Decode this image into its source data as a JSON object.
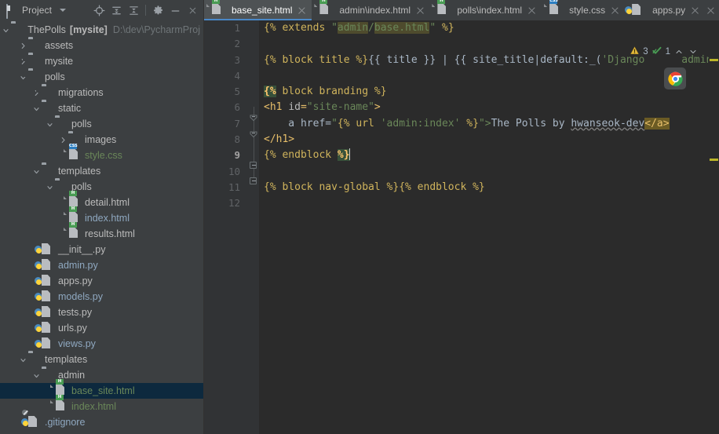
{
  "project_panel": {
    "title": "Project",
    "window_icon": "project-window-icon",
    "tools": [
      {
        "name": "locate-icon",
        "title": "Select Opened File"
      },
      {
        "name": "expand-all-icon",
        "title": "Expand All"
      },
      {
        "name": "collapse-all-icon",
        "title": "Collapse All"
      },
      {
        "name": "gear-icon",
        "title": "Settings"
      },
      {
        "name": "minimize-icon",
        "title": "Hide"
      },
      {
        "name": "close-icon",
        "title": "Close"
      }
    ],
    "tree": [
      {
        "depth": 0,
        "arrow": "down",
        "icon": "folder",
        "label": "ThePolls",
        "suffix": "[mysite]",
        "path": "D:\\dev\\PycharmProj",
        "style": "white"
      },
      {
        "depth": 1,
        "arrow": "right",
        "icon": "folder",
        "label": "assets",
        "style": "white"
      },
      {
        "depth": 1,
        "arrow": "right",
        "icon": "folder-module",
        "label": "mysite",
        "style": "white"
      },
      {
        "depth": 1,
        "arrow": "down",
        "icon": "folder-module",
        "label": "polls",
        "style": "white"
      },
      {
        "depth": 2,
        "arrow": "right",
        "icon": "folder-module",
        "label": "migrations",
        "style": "white"
      },
      {
        "depth": 2,
        "arrow": "down",
        "icon": "folder",
        "label": "static",
        "style": "white"
      },
      {
        "depth": 3,
        "arrow": "down",
        "icon": "folder",
        "label": "polls",
        "style": "white"
      },
      {
        "depth": 4,
        "arrow": "right",
        "icon": "folder",
        "label": "images",
        "style": "white"
      },
      {
        "depth": 4,
        "arrow": "none",
        "icon": "css-file",
        "label": "style.css",
        "style": "green"
      },
      {
        "depth": 2,
        "arrow": "down",
        "icon": "folder",
        "label": "templates",
        "style": "white"
      },
      {
        "depth": 3,
        "arrow": "down",
        "icon": "folder",
        "label": "polls",
        "style": "white"
      },
      {
        "depth": 4,
        "arrow": "none",
        "icon": "html-file",
        "label": "detail.html",
        "style": "white"
      },
      {
        "depth": 4,
        "arrow": "none",
        "icon": "html-file",
        "label": "index.html",
        "style": "blue"
      },
      {
        "depth": 4,
        "arrow": "none",
        "icon": "html-file",
        "label": "results.html",
        "style": "white"
      },
      {
        "depth": 2,
        "arrow": "none",
        "icon": "py-file",
        "label": "__init__.py",
        "style": "white"
      },
      {
        "depth": 2,
        "arrow": "none",
        "icon": "py-file",
        "label": "admin.py",
        "style": "blue"
      },
      {
        "depth": 2,
        "arrow": "none",
        "icon": "py-file",
        "label": "apps.py",
        "style": "white"
      },
      {
        "depth": 2,
        "arrow": "none",
        "icon": "py-file",
        "label": "models.py",
        "style": "blue"
      },
      {
        "depth": 2,
        "arrow": "none",
        "icon": "py-file",
        "label": "tests.py",
        "style": "white"
      },
      {
        "depth": 2,
        "arrow": "none",
        "icon": "py-file",
        "label": "urls.py",
        "style": "white"
      },
      {
        "depth": 2,
        "arrow": "none",
        "icon": "py-file",
        "label": "views.py",
        "style": "blue"
      },
      {
        "depth": 1,
        "arrow": "down",
        "icon": "folder",
        "label": "templates",
        "style": "white"
      },
      {
        "depth": 2,
        "arrow": "down",
        "icon": "folder",
        "label": "admin",
        "style": "white"
      },
      {
        "depth": 3,
        "arrow": "none",
        "icon": "html-file",
        "label": "base_site.html",
        "style": "green",
        "selected": true
      },
      {
        "depth": 3,
        "arrow": "none",
        "icon": "html-file",
        "label": "index.html",
        "style": "green"
      },
      {
        "depth": 1,
        "arrow": "none",
        "icon": "py-ignored-file",
        "label": ".gitignore",
        "style": "blue"
      }
    ]
  },
  "editor": {
    "tabs": [
      {
        "label": "base_site.html",
        "icon": "html-file",
        "active": true
      },
      {
        "label": "admin\\index.html",
        "icon": "html-file",
        "active": false
      },
      {
        "label": "polls\\index.html",
        "icon": "html-file",
        "active": false
      },
      {
        "label": "style.css",
        "icon": "css-file",
        "active": false
      },
      {
        "label": "apps.py",
        "icon": "py-file",
        "active": false
      }
    ],
    "tab_overflow_icon": "chevron-down-icon",
    "line_numbers": [
      "1",
      "2",
      "3",
      "4",
      "5",
      "6",
      "7",
      "8",
      "9",
      "10",
      "11",
      "12"
    ],
    "caret_line": 9,
    "inspection": {
      "warning_icon": "warning-triangle-icon",
      "warning_count": "3",
      "ok_icon": "inspection-ok-icon",
      "ok_count": "1",
      "prev_icon": "chevron-up-icon",
      "next_icon": "chevron-down-icon"
    },
    "browser_preview_icon": "chrome-icon",
    "code": {
      "l1_a": "{% extends ",
      "l1_q1": "\"",
      "l1_admin": "admin",
      "l1_slash": "/",
      "l1_base": "base.html",
      "l1_q2": "\"",
      "l1_b": " %}",
      "l3_a": "{% block title %}",
      "l3_b": "{{ title }}",
      "l3_c": " | ",
      "l3_d": "{{ site_title|default:_(",
      "l3_e": "'Django",
      "l3_f": "admin'",
      "l5_brace": "{%",
      "l5_rest": " block branding %}",
      "l6_a": "<h1 ",
      "l6_b": "id",
      "l6_c": "=",
      "l6_d": "\"site-name\"",
      "l6_e": ">",
      "l7_a": "    a href=",
      "l7_b": "\"",
      "l7_c": "{% url ",
      "l7_d": "'admin:index'",
      "l7_e": " %}",
      "l7_f": "\">",
      "l7_g": "The Polls by ",
      "l7_h": "hwanseok-dev",
      "l7_i": "</a>",
      "l8": "</h1>",
      "l9_a": "{% endblock ",
      "l9_b": "%}",
      "l11_a": "{% block nav-global %}",
      "l11_b": "{% endblock %}"
    }
  },
  "colors": {
    "panel_bg": "#3c3f41",
    "editor_bg": "#2b2b2b",
    "gutter_bg": "#313335",
    "selection_blue": "#0d293e",
    "tab_active": "#4e5254",
    "tab_underline": "#4a88c7",
    "warning_yellow": "#bbb529",
    "string_green": "#6a8759",
    "template_tag": "#d0b45c"
  }
}
